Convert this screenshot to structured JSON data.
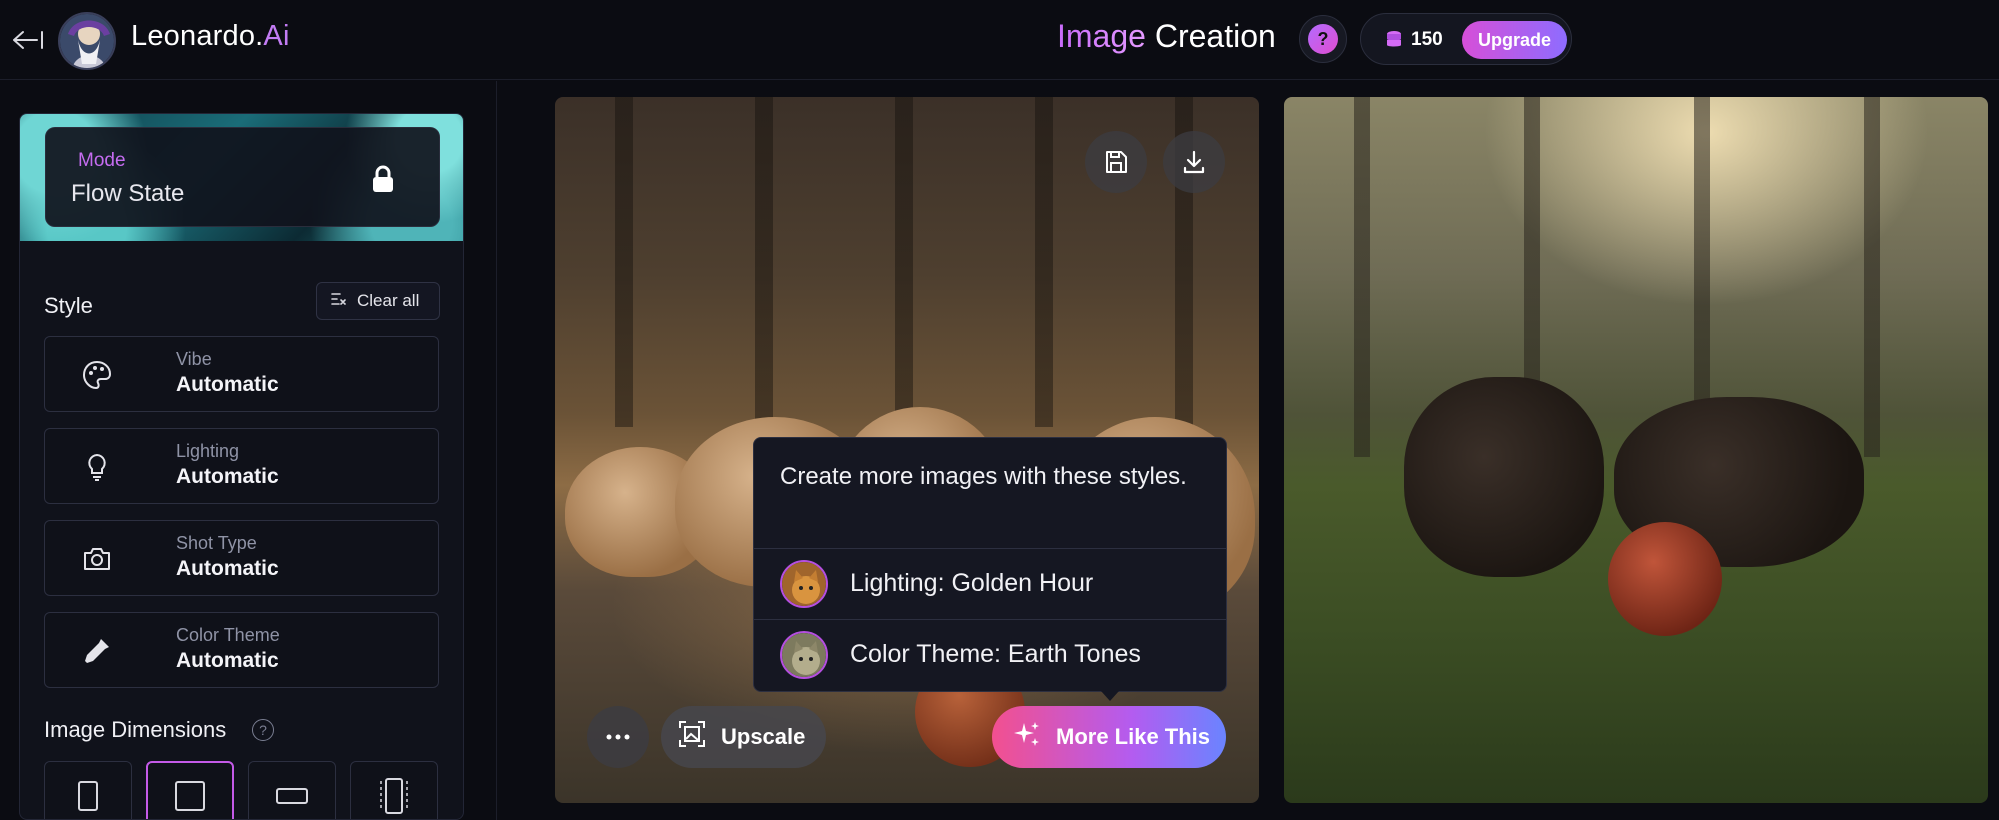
{
  "header": {
    "brand_name": "Leonardo.",
    "brand_suffix": "Ai",
    "title_accent": "Image",
    "title_rest": "Creation",
    "help_symbol": "?",
    "token_count": "150",
    "upgrade_label": "Upgrade"
  },
  "sidebar": {
    "mode": {
      "label": "Mode",
      "value": "Flow State"
    },
    "style_title": "Style",
    "clear_all_label": "Clear all",
    "options": [
      {
        "label": "Vibe",
        "value": "Automatic",
        "icon": "palette-icon"
      },
      {
        "label": "Lighting",
        "value": "Automatic",
        "icon": "lightbulb-icon"
      },
      {
        "label": "Shot Type",
        "value": "Automatic",
        "icon": "camera-icon"
      },
      {
        "label": "Color Theme",
        "value": "Automatic",
        "icon": "eyedropper-icon"
      }
    ],
    "dimensions_title": "Image Dimensions",
    "dimensions_help": "?",
    "dimension_options": [
      "portrait",
      "square",
      "landscape",
      "tall"
    ],
    "dimension_selected": "square"
  },
  "image_actions": {
    "upscale_label": "Upscale",
    "more_like_label": "More Like This"
  },
  "tooltip": {
    "text": "Create more images with these styles.",
    "rows": [
      {
        "text": "Lighting: Golden Hour"
      },
      {
        "text": "Color Theme: Earth Tones"
      }
    ]
  },
  "colors": {
    "accent": "#c37cf4",
    "background": "#0b0c12",
    "selected_border": "#c45ae8"
  }
}
